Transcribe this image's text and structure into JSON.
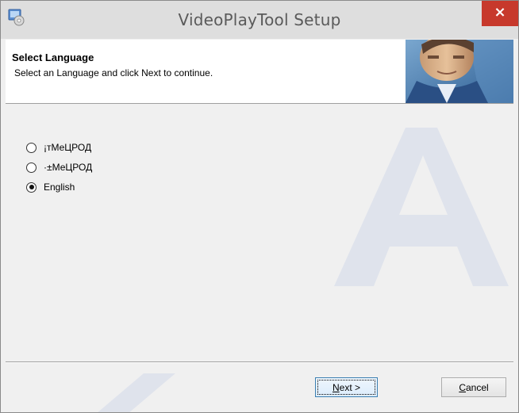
{
  "window": {
    "title": "VideoPlayTool Setup",
    "close_label": "×"
  },
  "header": {
    "title": "Select Language",
    "subtitle": "Select an Language and click Next to continue."
  },
  "languages": [
    {
      "label": "¡тМеЦРОД",
      "selected": false
    },
    {
      "label": "·±МеЦРОД",
      "selected": false
    },
    {
      "label": "English",
      "selected": true
    }
  ],
  "buttons": {
    "next_mnemonic": "N",
    "next_rest": "ext >",
    "cancel_mnemonic": "C",
    "cancel_rest": "ancel"
  },
  "colors": {
    "close_button": "#c7392c",
    "titlebar": "#dedede",
    "dialog_bg": "#f0f0f0"
  }
}
